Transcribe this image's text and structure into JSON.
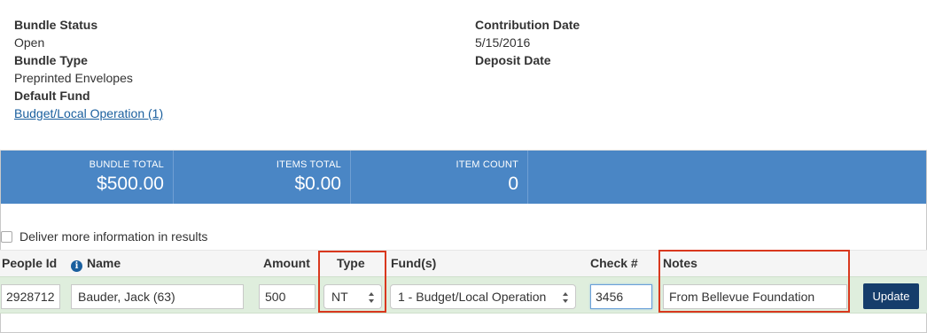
{
  "bundle": {
    "status_label": "Bundle Status",
    "status_value": "Open",
    "type_label": "Bundle Type",
    "type_value": "Preprinted Envelopes",
    "fund_label": "Default Fund",
    "fund_value": "Budget/Local Operation (1)",
    "contribution_date_label": "Contribution Date",
    "contribution_date_value": "5/15/2016",
    "deposit_date_label": "Deposit Date"
  },
  "stats": [
    {
      "title": "BUNDLE TOTAL",
      "value": "$500.00"
    },
    {
      "title": "ITEMS TOTAL",
      "value": "$0.00"
    },
    {
      "title": "ITEM COUNT",
      "value": "0"
    }
  ],
  "options": {
    "deliver_more_label": "Deliver more information in results"
  },
  "table": {
    "headers": {
      "people_id": "People Id",
      "name": "Name",
      "amount": "Amount",
      "type": "Type",
      "funds": "Fund(s)",
      "check": "Check #",
      "notes": "Notes"
    },
    "row": {
      "people_id": "2928712",
      "name": "Bauder, Jack (63)",
      "amount": "500",
      "type": "NT",
      "fund": "1 - Budget/Local Operation",
      "check": "3456",
      "notes": "From Bellevue Foundation"
    },
    "update_label": "Update"
  },
  "icons": {
    "name_info": "info-icon"
  },
  "colors": {
    "stats_bg": "#4a86c5",
    "row_bg": "#dfeedd",
    "button_bg": "#153d6b",
    "highlight": "#d9381e",
    "link": "#1a5f9e"
  }
}
